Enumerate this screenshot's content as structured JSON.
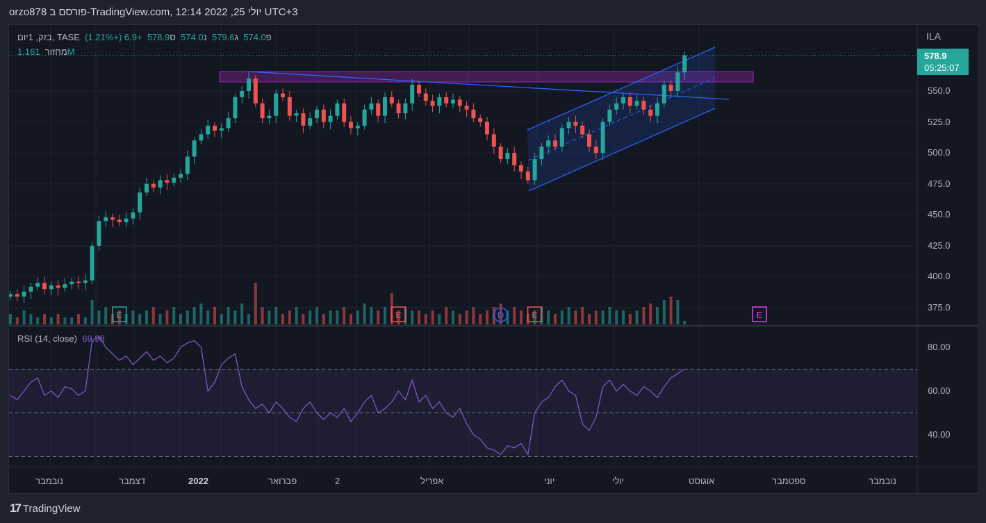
{
  "header": {
    "title": "orzo878 פורסם ב-TradingView.com, 12:14 2022 ,25 יולי UTC+3"
  },
  "legend": {
    "symbol": "בזק, 1יום, TASE",
    "o_label": "פ",
    "o": "574.0",
    "h_label": "ג",
    "h": "579.6",
    "l_label": "נ",
    "l": "574.0",
    "c_label": "ס",
    "c": "578.9",
    "change": "+6.9 (+1.21%)",
    "volume_label": "מחזור",
    "volume": "1.161M",
    "rsi_label": "RSI (14, close)",
    "rsi_value": "69.98"
  },
  "price_axis": {
    "currency": "ILA",
    "last_price": "578.9",
    "countdown": "05:25:07"
  },
  "footer": {
    "brand": "TradingView"
  },
  "colors": {
    "up": "#26a69a",
    "down": "#ef5350",
    "rsi": "#7e57c2",
    "channel": "#2962ff",
    "zone": "#9c27b0"
  },
  "chart_data": {
    "type": "candlestick",
    "price_ticks": [
      550,
      525,
      500,
      475,
      450,
      425,
      400,
      375
    ],
    "rsi_ticks": [
      80,
      60,
      40
    ],
    "rsi_levels": [
      70,
      50,
      30
    ],
    "x_ticks": [
      "נובמבר",
      "דצמבר",
      "2022",
      "פברואר",
      "2",
      "אפריל",
      "יוני",
      "יולי",
      "אוגוסט",
      "ספטמבר",
      "נובמבר"
    ],
    "events": [
      {
        "type": "E",
        "idx": 16
      },
      {
        "type": "E",
        "idx": 57
      },
      {
        "type": "D",
        "idx": 72
      },
      {
        "type": "E",
        "idx": 77
      },
      {
        "type": "E",
        "idx": 110
      }
    ],
    "closes": [
      386,
      384,
      388,
      392,
      395,
      390,
      393,
      391,
      394,
      396,
      395,
      397,
      425,
      445,
      448,
      446,
      444,
      447,
      452,
      468,
      475,
      472,
      478,
      476,
      480,
      483,
      497,
      510,
      515,
      522,
      518,
      520,
      528,
      545,
      550,
      560,
      540,
      528,
      530,
      548,
      545,
      530,
      532,
      522,
      528,
      535,
      525,
      530,
      540,
      525,
      520,
      522,
      535,
      540,
      530,
      545,
      540,
      532,
      540,
      555,
      548,
      542,
      538,
      545,
      540,
      543,
      538,
      535,
      528,
      525,
      515,
      505,
      495,
      500,
      490,
      485,
      478,
      495,
      505,
      510,
      505,
      520,
      525,
      522,
      515,
      505,
      500,
      525,
      535,
      540,
      545,
      538,
      542,
      535,
      530,
      540,
      555,
      550,
      565,
      578.9
    ],
    "volumes": [
      3,
      2,
      4,
      3,
      2,
      3,
      2,
      3,
      2,
      2,
      3,
      2,
      7,
      4,
      5,
      3,
      4,
      3,
      4,
      3,
      4,
      5,
      3,
      4,
      5,
      3,
      4,
      5,
      6,
      4,
      5,
      3,
      5,
      4,
      6,
      3,
      12,
      5,
      4,
      5,
      3,
      4,
      5,
      3,
      4,
      5,
      3,
      4,
      4,
      5,
      3,
      4,
      6,
      5,
      4,
      5,
      9,
      4,
      5,
      4,
      4,
      3,
      4,
      3,
      5,
      4,
      3,
      4,
      5,
      3,
      4,
      5,
      6,
      4,
      5,
      4,
      3,
      4,
      5,
      4,
      3,
      4,
      5,
      4,
      5,
      3,
      4,
      4,
      5,
      4,
      4,
      3,
      4,
      5,
      6,
      5,
      7,
      8,
      7,
      1
    ],
    "rsi": [
      58,
      56,
      60,
      64,
      66,
      58,
      60,
      57,
      62,
      61,
      58,
      60,
      83,
      85,
      80,
      77,
      74,
      76,
      72,
      75,
      78,
      74,
      76,
      73,
      75,
      80,
      82,
      83,
      80,
      60,
      64,
      72,
      75,
      77,
      62,
      56,
      52,
      54,
      50,
      55,
      52,
      48,
      46,
      52,
      55,
      50,
      47,
      50,
      48,
      52,
      46,
      50,
      55,
      58,
      50,
      52,
      55,
      60,
      56,
      65,
      55,
      58,
      52,
      55,
      50,
      48,
      52,
      45,
      40,
      38,
      34,
      33,
      31,
      35,
      34,
      36,
      31,
      50,
      55,
      57,
      62,
      65,
      60,
      58,
      45,
      42,
      48,
      62,
      65,
      60,
      63,
      60,
      58,
      62,
      60,
      57,
      62,
      66,
      68,
      70
    ]
  }
}
